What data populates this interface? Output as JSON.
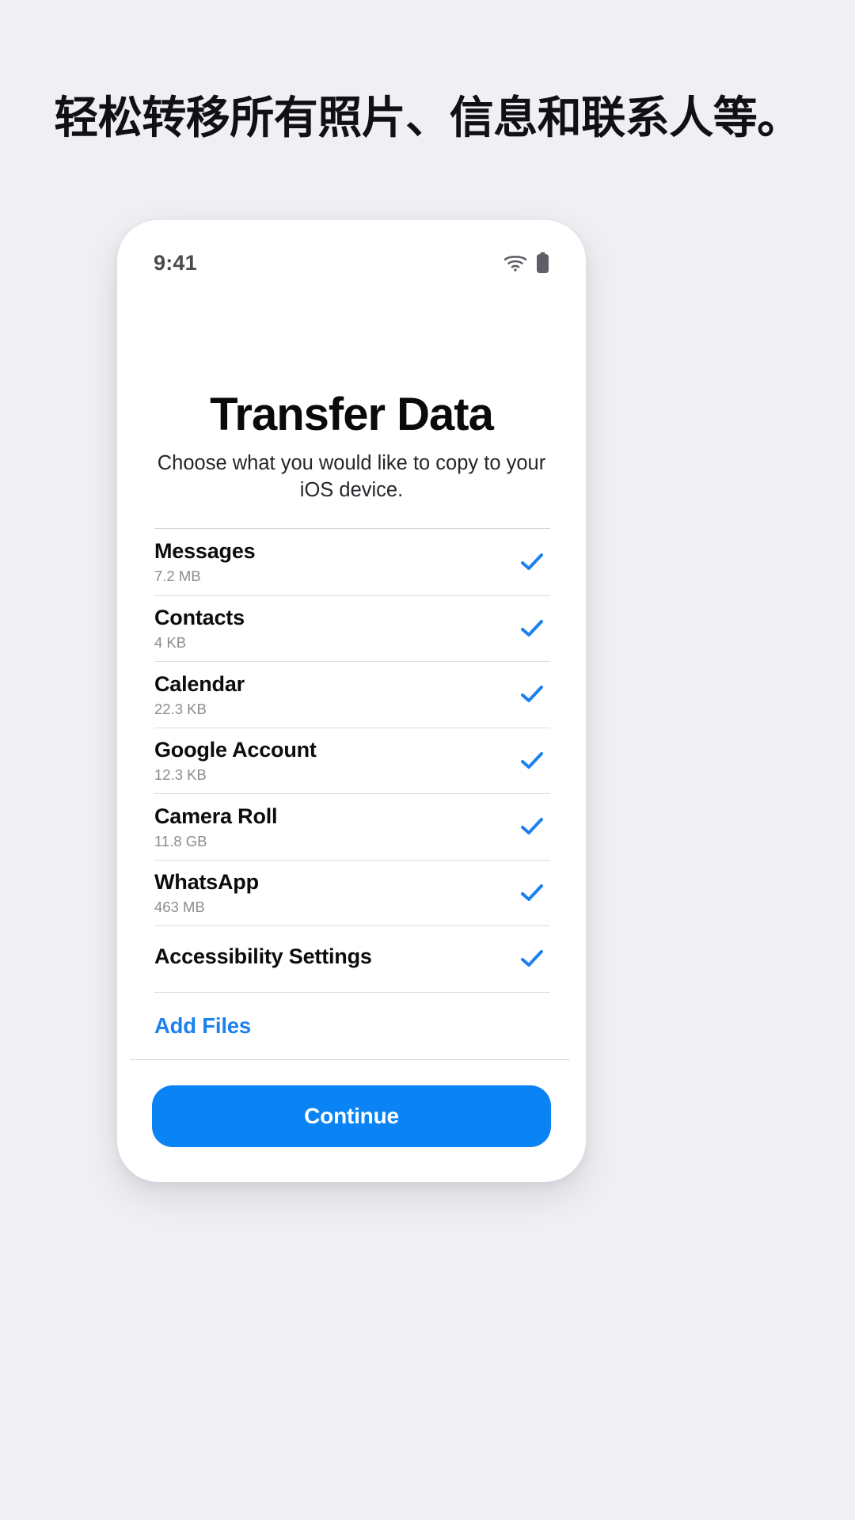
{
  "page": {
    "background_color": "#f0f0f4",
    "headline": "轻松转移所有照片、信息和联系人等。"
  },
  "phone": {
    "status_bar": {
      "time": "9:41",
      "wifi_icon": "wifi-icon",
      "battery_icon": "battery-icon"
    },
    "screen": {
      "title": "Transfer Data",
      "subtitle": "Choose what you would like to copy to your iOS device.",
      "accent_color": "#0a84f5",
      "check_color": "#1b81f0",
      "items": [
        {
          "label": "Messages",
          "size": "7.2 MB",
          "checked": true,
          "check_icon": "check-icon"
        },
        {
          "label": "Contacts",
          "size": "4 KB",
          "checked": true,
          "check_icon": "check-icon"
        },
        {
          "label": "Calendar",
          "size": "22.3 KB",
          "checked": true,
          "check_icon": "check-icon"
        },
        {
          "label": "Google Account",
          "size": "12.3 KB",
          "checked": true,
          "check_icon": "check-icon"
        },
        {
          "label": "Camera Roll",
          "size": "11.8 GB",
          "checked": true,
          "check_icon": "check-icon"
        },
        {
          "label": "WhatsApp",
          "size": "463 MB",
          "checked": true,
          "check_icon": "check-icon"
        },
        {
          "label": "Accessibility Settings",
          "size": "",
          "checked": true,
          "check_icon": "check-icon"
        }
      ],
      "add_files_label": "Add Files",
      "continue_label": "Continue"
    }
  }
}
